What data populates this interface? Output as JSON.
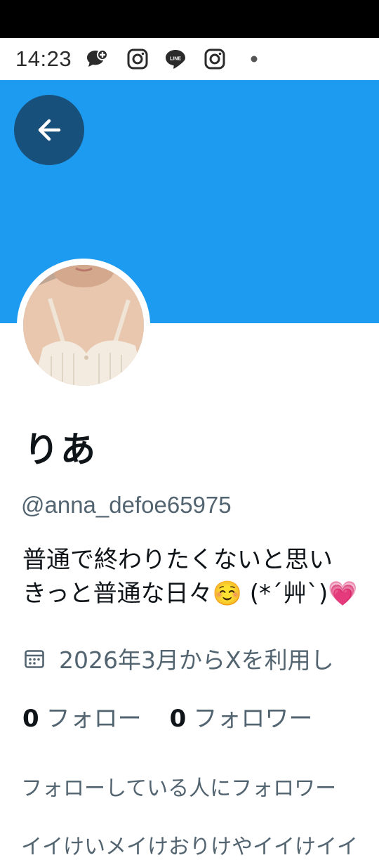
{
  "status_bar": {
    "time": "14:23",
    "icons": [
      "chat-plus-icon",
      "instagram-icon",
      "line-icon",
      "instagram-icon",
      "dot-icon"
    ]
  },
  "colors": {
    "banner": "#1d9bf0",
    "back_button": "#17507a",
    "primary_text": "#0f1419",
    "secondary_text": "#536471"
  },
  "profile": {
    "display_name": "りあ",
    "handle": "@anna_defoe65975",
    "bio_line1": "普通で終わりたくないと思い",
    "bio_line2": "きっと普通な日々☺️ (*´艸`)💗",
    "joined": "2026年3月からXを利用し",
    "following_count": "0",
    "following_label": "フォロー",
    "followers_count": "0",
    "followers_label": "フォロワー",
    "not_followed_text": "フォローしている人にフォロワー",
    "cut_off_text": "イイけいメイけおりけやイイけイイ"
  }
}
